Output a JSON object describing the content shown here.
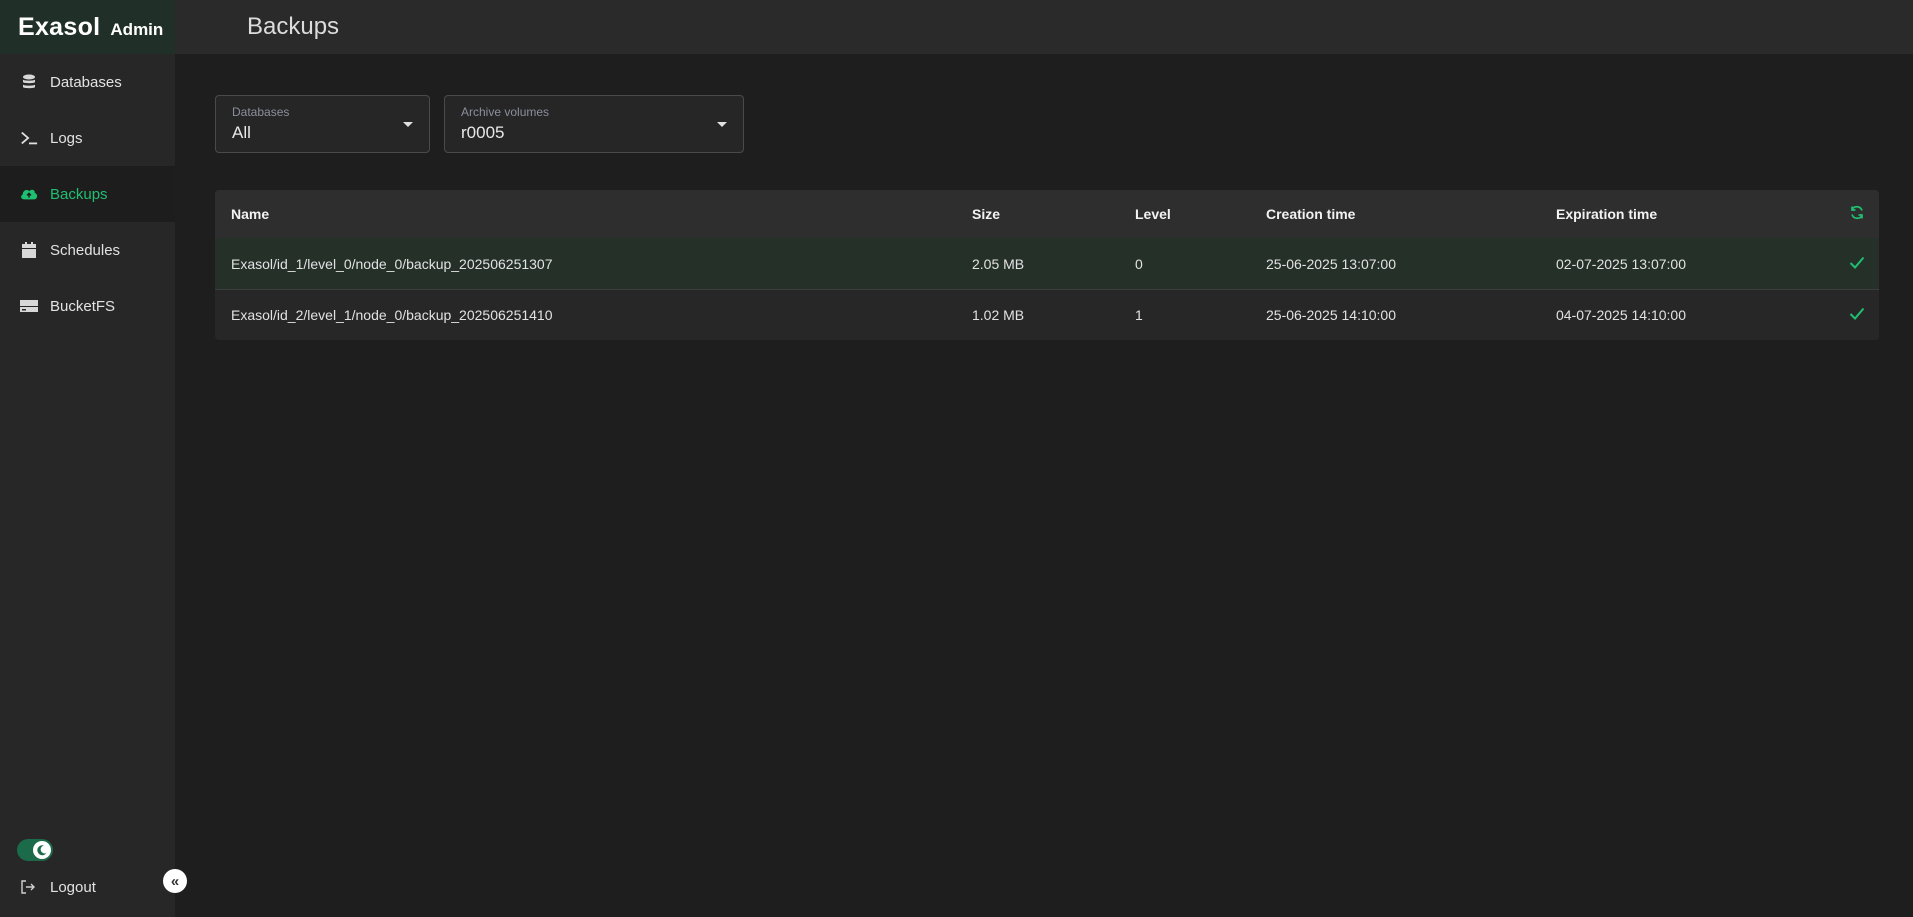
{
  "brand": {
    "logo": "Exasol",
    "suffix": "Admin"
  },
  "sidebar": {
    "items": [
      {
        "label": "Databases",
        "icon": "database-icon"
      },
      {
        "label": "Logs",
        "icon": "terminal-icon"
      },
      {
        "label": "Backups",
        "icon": "cloud-upload-icon",
        "active": true
      },
      {
        "label": "Schedules",
        "icon": "calendar-icon"
      },
      {
        "label": "BucketFS",
        "icon": "storage-icon"
      }
    ],
    "logout_label": "Logout",
    "theme_toggle": "dark"
  },
  "header": {
    "title": "Backups"
  },
  "filters": {
    "databases": {
      "label": "Databases",
      "value": "All"
    },
    "archive_volumes": {
      "label": "Archive volumes",
      "value": "r0005"
    }
  },
  "table": {
    "columns": [
      "Name",
      "Size",
      "Level",
      "Creation time",
      "Expiration time"
    ],
    "rows": [
      {
        "name": "Exasol/id_1/level_0/node_0/backup_202506251307",
        "size": "2.05 MB",
        "level": "0",
        "creation_time": "25-06-2025 13:07:00",
        "expiration_time": "02-07-2025 13:07:00",
        "status": "check-icon"
      },
      {
        "name": "Exasol/id_2/level_1/node_0/backup_202506251410",
        "size": "1.02 MB",
        "level": "1",
        "creation_time": "25-06-2025 14:10:00",
        "expiration_time": "04-07-2025 14:10:00",
        "status": "check-icon"
      }
    ]
  },
  "colors": {
    "accent": "#1fbf71",
    "background": "#1e1e1e",
    "sidebar": "#272727",
    "brand_bg": "#203029"
  }
}
